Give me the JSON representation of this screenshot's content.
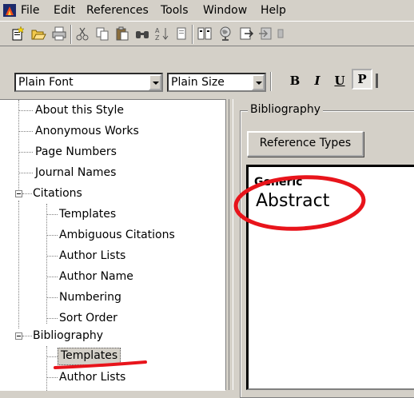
{
  "menu": {
    "items": [
      "File",
      "Edit",
      "References",
      "Tools",
      "Window",
      "Help"
    ]
  },
  "toolbar": {
    "icons": [
      "new-style-icon",
      "open-icon",
      "print-icon",
      "cut-icon",
      "copy-icon",
      "paste-icon",
      "find-icon",
      "sort-icon",
      "page-icon",
      "layout-icon",
      "globe-icon",
      "export-icon",
      "import-icon"
    ]
  },
  "format_bar": {
    "font_value": "Plain Font",
    "size_value": "Plain Size",
    "bold_label": "B",
    "italic_label": "I",
    "underline_label": "U",
    "plain_label": "P"
  },
  "tree": {
    "items": [
      {
        "label": "About this Style",
        "level": 0
      },
      {
        "label": "Anonymous Works",
        "level": 0
      },
      {
        "label": "Page Numbers",
        "level": 0
      },
      {
        "label": "Journal Names",
        "level": 0
      },
      {
        "label": "Citations",
        "level": 0,
        "expandable": true
      },
      {
        "label": "Templates",
        "level": 1
      },
      {
        "label": "Ambiguous Citations",
        "level": 1
      },
      {
        "label": "Author Lists",
        "level": 1
      },
      {
        "label": "Author Name",
        "level": 1
      },
      {
        "label": "Numbering",
        "level": 1
      },
      {
        "label": "Sort Order",
        "level": 1
      },
      {
        "label": "Bibliography",
        "level": 0,
        "expandable": true
      },
      {
        "label": "Templates",
        "level": 1,
        "selected": true
      },
      {
        "label": "Author Lists",
        "level": 1
      }
    ]
  },
  "bibliography_panel": {
    "group_label": "Bibliography",
    "reference_types_button": "Reference Types",
    "reference_type_name": "Generic",
    "field_text": "Abstract"
  },
  "colors": {
    "window_bg": "#d4d0c8",
    "annotation_red": "#e8141b"
  }
}
